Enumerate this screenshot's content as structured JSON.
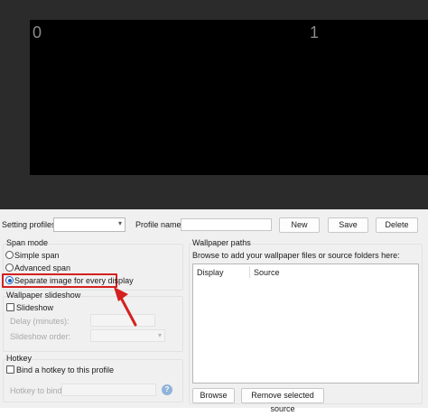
{
  "preview": {
    "display_labels": [
      "0",
      "1"
    ]
  },
  "profiles": {
    "setting_profiles_label": "Setting profiles:",
    "setting_profiles_value": "",
    "profile_name_label": "Profile name:",
    "profile_name_value": "",
    "new_label": "New",
    "save_label": "Save",
    "delete_label": "Delete"
  },
  "span_mode": {
    "title": "Span mode",
    "options": [
      "Simple span",
      "Advanced span",
      "Separate image for every display"
    ],
    "selected": "Separate image for every display"
  },
  "slideshow": {
    "title": "Wallpaper slideshow",
    "checkbox_label": "Slideshow",
    "checked": false,
    "delay_label": "Delay (minutes):",
    "order_label": "Slideshow order:",
    "order_value": ""
  },
  "hotkey": {
    "title": "Hotkey",
    "checkbox_label": "Bind a hotkey to this profile",
    "checked": false,
    "bind_label": "Hotkey to bind:",
    "help_glyph": "?"
  },
  "paths": {
    "title": "Wallpaper paths",
    "description": "Browse to add your wallpaper files or source folders here:",
    "columns": [
      "Display",
      "Source"
    ],
    "browse_label": "Browse",
    "remove_label": "Remove selected source"
  },
  "colors": {
    "accent": "#1f5fbf",
    "highlight": "#d42020",
    "preview_bg": "#2b2b2b"
  }
}
